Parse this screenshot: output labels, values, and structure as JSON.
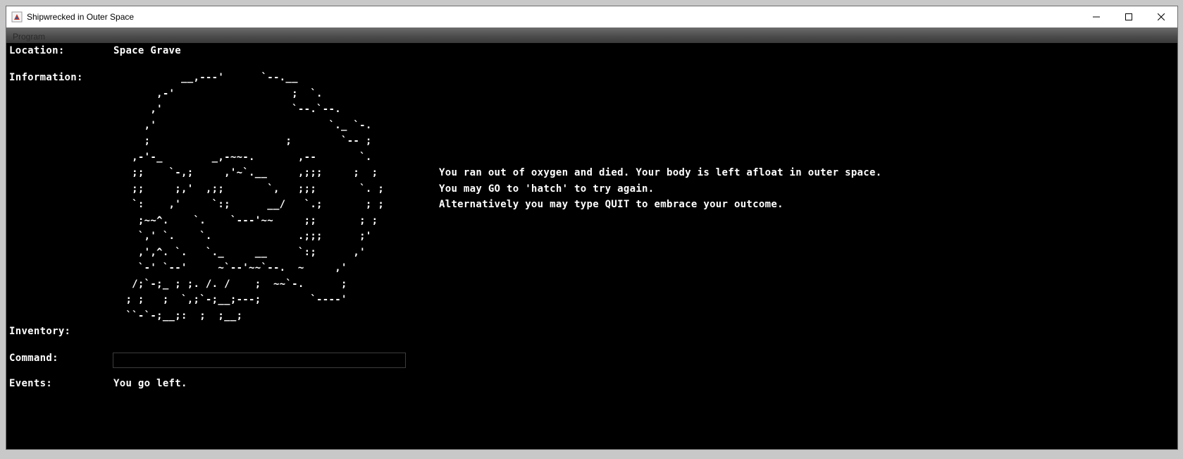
{
  "window": {
    "title": "Shipwrecked in Outer Space"
  },
  "menu": {
    "items": [
      "Program"
    ]
  },
  "labels": {
    "location": "Location:",
    "information": "Information:",
    "inventory": "Inventory:",
    "command": "Command:",
    "events": "Events:"
  },
  "location": "Space Grave",
  "information": {
    "art_lines": [
      "           __,---'      `--.__",
      "       ,-'                   ;  `.",
      "      ,'                     `--.`--.",
      "     ,'                            `._ `-.",
      "     ;                      ;        `-- ;",
      "   ,-'-_        _,-~~-.       ,--       `.",
      "   ;;    `-,;     ,'~`.__     ,;;;     ;  ;",
      "   ;;     ;,'  ,;;       `,   ;;;       `. ;",
      "   `:    ,'     `:;      __/   `.;       ; ;",
      "    ;~~^.    `.    `---'~~     ;;       ; ;",
      "    `,' `.    `.              .;;;      ;'",
      "    ,',^. `.   `._     __     `:;      ,'",
      "    `-' `--'     ~`--'~~`--.  ~     ,'",
      "   /;`-;_ ; ;. /. /    ;  ~~`-.      ;",
      "  ; ;   ;  `,;`-;__;---;        `----'",
      "  ``-`-;__;:  ;  ;__;"
    ],
    "message_lines": [
      "You ran out of oxygen and died. Your body is left afloat in outer space.",
      "You may GO to 'hatch' to try again.",
      "Alternatively you may type QUIT to embrace your outcome."
    ]
  },
  "inventory": "",
  "command": {
    "value": ""
  },
  "events": "You go left."
}
